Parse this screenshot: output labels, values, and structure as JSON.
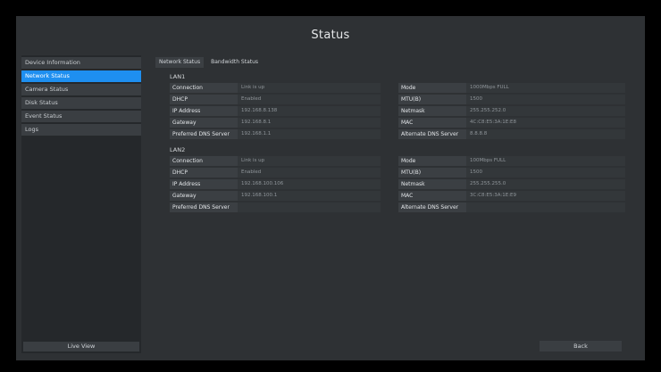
{
  "title": "Status",
  "sidebar": {
    "items": [
      {
        "label": "Device Information"
      },
      {
        "label": "Network Status"
      },
      {
        "label": "Camera Status"
      },
      {
        "label": "Disk Status"
      },
      {
        "label": "Event Status"
      },
      {
        "label": "Logs"
      }
    ],
    "live_view_label": "Live View"
  },
  "tabs": [
    {
      "label": "Network Status"
    },
    {
      "label": "Bandwidth Status"
    }
  ],
  "lan1": {
    "title": "LAN1",
    "left": [
      {
        "label": "Connection",
        "value": "Link is up"
      },
      {
        "label": "DHCP",
        "value": "Enabled"
      },
      {
        "label": "IP Address",
        "value": "192.168.8.138"
      },
      {
        "label": "Gateway",
        "value": "192.168.8.1"
      },
      {
        "label": "Preferred DNS Server",
        "value": "192.168.1.1"
      }
    ],
    "right": [
      {
        "label": "Mode",
        "value": "1000Mbps FULL"
      },
      {
        "label": "MTU(B)",
        "value": "1500"
      },
      {
        "label": "Netmask",
        "value": "255.255.252.0"
      },
      {
        "label": "MAC",
        "value": "4C:C8:E5:3A:1E:E8"
      },
      {
        "label": "Alternate DNS Server",
        "value": "8.8.8.8"
      }
    ]
  },
  "lan2": {
    "title": "LAN2",
    "left": [
      {
        "label": "Connection",
        "value": "Link is up"
      },
      {
        "label": "DHCP",
        "value": "Enabled"
      },
      {
        "label": "IP Address",
        "value": "192.168.100.106"
      },
      {
        "label": "Gateway",
        "value": "192.168.100.1"
      },
      {
        "label": "Preferred DNS Server",
        "value": ""
      }
    ],
    "right": [
      {
        "label": "Mode",
        "value": "100Mbps FULL"
      },
      {
        "label": "MTU(B)",
        "value": "1500"
      },
      {
        "label": "Netmask",
        "value": "255.255.255.0"
      },
      {
        "label": "MAC",
        "value": "3C:C8:E5:3A:1E:E9"
      },
      {
        "label": "Alternate DNS Server",
        "value": ""
      }
    ]
  },
  "back_label": "Back"
}
